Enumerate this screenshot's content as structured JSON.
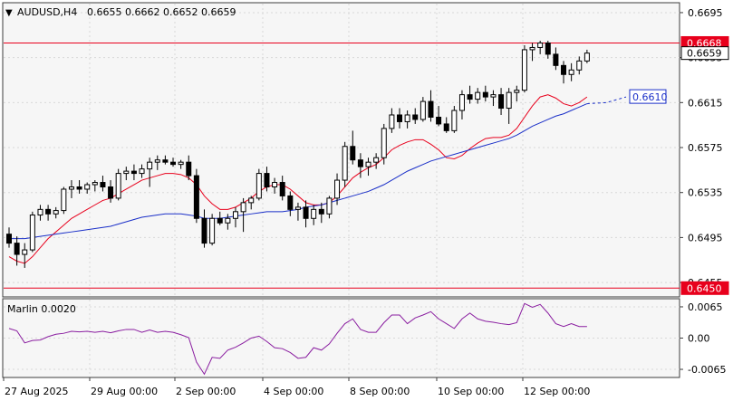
{
  "colors": {
    "background": "#ffffff",
    "plot_bg": "#f6f6f6",
    "frame": "#3c3c3c",
    "grid": "#d8d8d8",
    "candle": "#000000",
    "candle_fill_up": "#ffffff",
    "ma_fast": "#e8001c",
    "ma_slow": "#1a2fc8",
    "resistance_line": "#e8001c",
    "oscillator": "#8a1ea0"
  },
  "header": {
    "arrow": "▼",
    "symbol": "AUDUSD,H4",
    "ohlc": "0.6655 0.6662 0.6652 0.6659"
  },
  "price_axis": {
    "ticks": [
      "0.6695",
      "0.6655",
      "0.6615",
      "0.6575",
      "0.6535",
      "0.6495",
      "0.6455"
    ],
    "current_price": "0.6659",
    "resistance_label": "0.6668",
    "support_label": "0.6450",
    "ma_label": "0.6610"
  },
  "indicator": {
    "label": "Marlin 0.0020",
    "ticks": [
      "0.0065",
      "0.00",
      "-0.0065"
    ]
  },
  "time_axis": {
    "labels": [
      "27 Aug 2025",
      "29 Aug 00:00",
      "2 Sep 00:00",
      "4 Sep 00:00",
      "8 Sep 00:00",
      "10 Sep 00:00",
      "12 Sep 00:00"
    ]
  },
  "chart_data": {
    "type": "candlestick",
    "symbol": "AUDUSD",
    "timeframe": "H4",
    "price_range": [
      0.6443,
      0.6703
    ],
    "horizontal_levels": [
      0.6668,
      0.645
    ],
    "candles": [
      [
        0.6498,
        0.6504,
        0.6486,
        0.649
      ],
      [
        0.649,
        0.6496,
        0.647,
        0.648
      ],
      [
        0.648,
        0.649,
        0.6468,
        0.6484
      ],
      [
        0.6484,
        0.6518,
        0.6482,
        0.6515
      ],
      [
        0.6515,
        0.6524,
        0.651,
        0.652
      ],
      [
        0.652,
        0.6524,
        0.651,
        0.6516
      ],
      [
        0.6516,
        0.6522,
        0.6512,
        0.6519
      ],
      [
        0.6519,
        0.654,
        0.6516,
        0.6538
      ],
      [
        0.6538,
        0.6546,
        0.653,
        0.654
      ],
      [
        0.654,
        0.6546,
        0.6534,
        0.6538
      ],
      [
        0.6538,
        0.6544,
        0.6534,
        0.6542
      ],
      [
        0.6542,
        0.6546,
        0.6536,
        0.6544
      ],
      [
        0.6544,
        0.655,
        0.6536,
        0.654
      ],
      [
        0.654,
        0.6546,
        0.6526,
        0.653
      ],
      [
        0.653,
        0.6556,
        0.6528,
        0.6552
      ],
      [
        0.6552,
        0.6558,
        0.6546,
        0.6554
      ],
      [
        0.6554,
        0.656,
        0.6546,
        0.6552
      ],
      [
        0.6552,
        0.656,
        0.6548,
        0.6556
      ],
      [
        0.6556,
        0.6566,
        0.654,
        0.6562
      ],
      [
        0.6562,
        0.6568,
        0.6555,
        0.6564
      ],
      [
        0.6564,
        0.6568,
        0.656,
        0.6562
      ],
      [
        0.6562,
        0.6566,
        0.6558,
        0.656
      ],
      [
        0.656,
        0.6564,
        0.6556,
        0.6562
      ],
      [
        0.6562,
        0.6568,
        0.6546,
        0.655
      ],
      [
        0.655,
        0.6556,
        0.6508,
        0.6512
      ],
      [
        0.6512,
        0.652,
        0.6486,
        0.649
      ],
      [
        0.649,
        0.6516,
        0.6488,
        0.6512
      ],
      [
        0.6512,
        0.6518,
        0.6506,
        0.6508
      ],
      [
        0.6508,
        0.6516,
        0.6502,
        0.6512
      ],
      [
        0.6512,
        0.6522,
        0.6504,
        0.6518
      ],
      [
        0.6518,
        0.653,
        0.65,
        0.6526
      ],
      [
        0.6526,
        0.6532,
        0.652,
        0.653
      ],
      [
        0.653,
        0.6556,
        0.6528,
        0.6552
      ],
      [
        0.6552,
        0.6558,
        0.6536,
        0.654
      ],
      [
        0.654,
        0.6548,
        0.6534,
        0.6544
      ],
      [
        0.6544,
        0.655,
        0.6528,
        0.6532
      ],
      [
        0.6532,
        0.6536,
        0.6514,
        0.652
      ],
      [
        0.652,
        0.6526,
        0.651,
        0.6522
      ],
      [
        0.6522,
        0.6528,
        0.6504,
        0.6512
      ],
      [
        0.6512,
        0.6524,
        0.6506,
        0.652
      ],
      [
        0.652,
        0.6526,
        0.6508,
        0.6516
      ],
      [
        0.6516,
        0.6532,
        0.6512,
        0.653
      ],
      [
        0.653,
        0.6552,
        0.6524,
        0.6546
      ],
      [
        0.6546,
        0.658,
        0.654,
        0.6576
      ],
      [
        0.6576,
        0.659,
        0.656,
        0.6564
      ],
      [
        0.6564,
        0.657,
        0.6548,
        0.6558
      ],
      [
        0.6558,
        0.6566,
        0.655,
        0.6562
      ],
      [
        0.6562,
        0.657,
        0.6556,
        0.6566
      ],
      [
        0.6566,
        0.6596,
        0.656,
        0.6592
      ],
      [
        0.6592,
        0.661,
        0.6588,
        0.6604
      ],
      [
        0.6604,
        0.661,
        0.6592,
        0.6598
      ],
      [
        0.6598,
        0.6608,
        0.6592,
        0.6604
      ],
      [
        0.6604,
        0.661,
        0.6596,
        0.66
      ],
      [
        0.66,
        0.662,
        0.6598,
        0.6616
      ],
      [
        0.6616,
        0.6626,
        0.6598,
        0.6602
      ],
      [
        0.6602,
        0.6612,
        0.6594,
        0.6596
      ],
      [
        0.6596,
        0.6602,
        0.6588,
        0.659
      ],
      [
        0.659,
        0.6612,
        0.6588,
        0.6608
      ],
      [
        0.6608,
        0.6626,
        0.66,
        0.6622
      ],
      [
        0.6622,
        0.663,
        0.6614,
        0.6618
      ],
      [
        0.6618,
        0.6628,
        0.6614,
        0.6624
      ],
      [
        0.6624,
        0.663,
        0.6616,
        0.662
      ],
      [
        0.662,
        0.6626,
        0.6612,
        0.6622
      ],
      [
        0.6622,
        0.6628,
        0.6604,
        0.661
      ],
      [
        0.661,
        0.6628,
        0.6596,
        0.6624
      ],
      [
        0.6624,
        0.663,
        0.6616,
        0.6626
      ],
      [
        0.6626,
        0.6666,
        0.6624,
        0.6662
      ],
      [
        0.6662,
        0.6668,
        0.6652,
        0.6664
      ],
      [
        0.6664,
        0.667,
        0.6658,
        0.6668
      ],
      [
        0.6668,
        0.667,
        0.6654,
        0.6658
      ],
      [
        0.6658,
        0.6664,
        0.6644,
        0.6648
      ],
      [
        0.6648,
        0.6652,
        0.6632,
        0.664
      ],
      [
        0.664,
        0.665,
        0.6634,
        0.6644
      ],
      [
        0.6644,
        0.6656,
        0.664,
        0.6652
      ],
      [
        0.6652,
        0.6662,
        0.665,
        0.6659
      ]
    ],
    "ma_fast": [
      0.6478,
      0.6474,
      0.6472,
      0.6478,
      0.6486,
      0.6494,
      0.65,
      0.6506,
      0.6512,
      0.6516,
      0.652,
      0.6524,
      0.6528,
      0.653,
      0.6534,
      0.6538,
      0.6542,
      0.6546,
      0.6548,
      0.655,
      0.6552,
      0.6552,
      0.6551,
      0.6548,
      0.6542,
      0.6532,
      0.6525,
      0.652,
      0.652,
      0.6522,
      0.6526,
      0.653,
      0.6536,
      0.654,
      0.6542,
      0.6542,
      0.6538,
      0.6532,
      0.6526,
      0.6524,
      0.6524,
      0.6526,
      0.6532,
      0.654,
      0.6548,
      0.6553,
      0.6557,
      0.656,
      0.6566,
      0.6573,
      0.6577,
      0.658,
      0.6582,
      0.6582,
      0.6578,
      0.6573,
      0.6566,
      0.6565,
      0.6568,
      0.6574,
      0.6579,
      0.6583,
      0.6584,
      0.6584,
      0.6586,
      0.6592,
      0.6602,
      0.6612,
      0.662,
      0.6622,
      0.6619,
      0.6614,
      0.6612,
      0.6615,
      0.662
    ],
    "ma_slow": [
      0.6494,
      0.6494,
      0.6494,
      0.6495,
      0.6496,
      0.6497,
      0.6498,
      0.6499,
      0.65,
      0.6501,
      0.6502,
      0.6503,
      0.6504,
      0.6505,
      0.6507,
      0.6509,
      0.6511,
      0.6513,
      0.6514,
      0.6515,
      0.6516,
      0.6516,
      0.6516,
      0.6515,
      0.6514,
      0.6512,
      0.6512,
      0.6512,
      0.6513,
      0.6514,
      0.6515,
      0.6516,
      0.6517,
      0.6518,
      0.6518,
      0.6518,
      0.6519,
      0.652,
      0.6522,
      0.6523,
      0.6524,
      0.6526,
      0.6528,
      0.653,
      0.6532,
      0.6534,
      0.6536,
      0.6539,
      0.6542,
      0.6546,
      0.655,
      0.6554,
      0.6557,
      0.656,
      0.6563,
      0.6565,
      0.6567,
      0.6569,
      0.6571,
      0.6573,
      0.6575,
      0.6577,
      0.6579,
      0.6581,
      0.6583,
      0.6586,
      0.659,
      0.6594,
      0.6597,
      0.66,
      0.6603,
      0.6605,
      0.6608,
      0.6611,
      0.6614
    ],
    "ma_slow_projection": [
      0.6615,
      0.662
    ],
    "marlin": [
      0.002,
      0.0015,
      -0.001,
      -0.0005,
      -0.0004,
      0.0003,
      0.0008,
      0.001,
      0.0014,
      0.0013,
      0.0014,
      0.0012,
      0.0014,
      0.0011,
      0.0015,
      0.0018,
      0.0018,
      0.0012,
      0.0017,
      0.0012,
      0.0014,
      0.0012,
      0.0007,
      0.0001,
      -0.005,
      -0.0075,
      -0.004,
      -0.0042,
      -0.0025,
      -0.0019,
      -0.001,
      0.0,
      0.0004,
      -0.0007,
      -0.002,
      -0.0022,
      -0.003,
      -0.0042,
      -0.004,
      -0.002,
      -0.0025,
      -0.0012,
      0.001,
      0.003,
      0.004,
      0.0018,
      0.0012,
      0.0012,
      0.0032,
      0.0048,
      0.0048,
      0.003,
      0.0042,
      0.0048,
      0.0055,
      0.004,
      0.003,
      0.002,
      0.004,
      0.0052,
      0.004,
      0.0035,
      0.0033,
      0.003,
      0.0028,
      0.0032,
      0.0072,
      0.0064,
      0.007,
      0.0052,
      0.003,
      0.0024,
      0.003,
      0.0024,
      0.0024
    ],
    "marlin_range": [
      -0.008,
      0.008
    ]
  }
}
